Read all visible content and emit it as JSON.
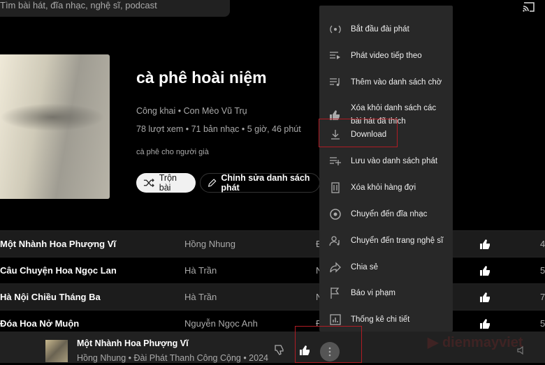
{
  "search": {
    "placeholder": "Tìm bài hát, đĩa nhạc, nghệ sĩ, podcast"
  },
  "playlist": {
    "title": "cà phê hoài niệm",
    "owner_line": "Công khai • Con Mèo Vũ Trụ",
    "stats": "78 lượt xem • 71 bản nhạc • 5 giờ, 46 phút",
    "description": "cà phê cho người già",
    "shuffle_label": "Trộn bài",
    "edit_label": "Chỉnh sửa danh sách phát"
  },
  "tracks": [
    {
      "title": "Một Nhành Hoa Phượng Vĩ",
      "artist": "Hồng Nhung",
      "album": "Đ",
      "duration": "4"
    },
    {
      "title": "Câu Chuyện Hoa Ngọc Lan",
      "artist": "Hà Trần",
      "album": "N",
      "duration": "5"
    },
    {
      "title": "Hà Nội Chiều Tháng Ba",
      "artist": "Hà Trần",
      "album": "N",
      "duration": "7"
    },
    {
      "title": "Đóa Hoa Nở Muộn",
      "artist": "Nguyễn Ngọc Anh",
      "album": "Đ",
      "duration": "5"
    }
  ],
  "player": {
    "title": "Một Nhành Hoa Phượng Vĩ",
    "subtitle": "Hồng Nhung • Đài Phát Thanh Công Cộng • 2024"
  },
  "menu": {
    "items": [
      {
        "label": "Bắt đầu đài phát",
        "icon": "radio-icon"
      },
      {
        "label": "Phát video tiếp theo",
        "icon": "play-next-icon"
      },
      {
        "label": "Thêm vào danh sách chờ",
        "icon": "add-to-queue-icon"
      },
      {
        "label": "Xóa khỏi danh sách các bài hát đã thích",
        "icon": "thumbs-up-icon"
      },
      {
        "label": "Download",
        "icon": "download-icon"
      },
      {
        "label": "Lưu vào danh sách phát",
        "icon": "playlist-add-icon"
      },
      {
        "label": "Xóa khỏi hàng đợi",
        "icon": "trash-icon"
      },
      {
        "label": "Chuyển đến đĩa nhạc",
        "icon": "album-icon"
      },
      {
        "label": "Chuyển đến trang nghệ sĩ",
        "icon": "artist-icon"
      },
      {
        "label": "Chia sẻ",
        "icon": "share-icon"
      },
      {
        "label": "Báo vi phạm",
        "icon": "flag-icon"
      },
      {
        "label": "Thống kê chi tiết",
        "icon": "stats-icon"
      }
    ]
  },
  "watermark": "dienmayviet",
  "colors": {
    "highlight": "#b01c24",
    "menu_bg": "#282828",
    "background": "#000000"
  }
}
